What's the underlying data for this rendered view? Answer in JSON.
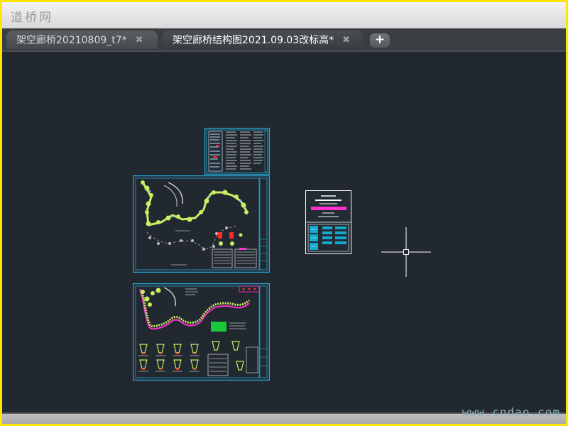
{
  "app": {
    "watermark_logo": "道桥网",
    "site_watermark": "www.cndao.com"
  },
  "tabs": [
    {
      "label": "架空廊桥20210809_t7*",
      "close": "✖",
      "active": false
    },
    {
      "label": "架空廊桥结构图2021.09.03改标高*",
      "close": "✖",
      "active": true
    }
  ],
  "new_tab_label": "+",
  "colors": {
    "canvas_bg": "#212830",
    "frame_border": "#ffe600",
    "sheet_border": "#2aa7d4",
    "tree_green": "#c8f060",
    "note_magenta": "#ff33cc",
    "highlight_red": "#ff2a2a",
    "cyan_panel": "#14a9cf"
  },
  "icons": {
    "crosshair": "cad-crosshair-cursor-icon"
  }
}
